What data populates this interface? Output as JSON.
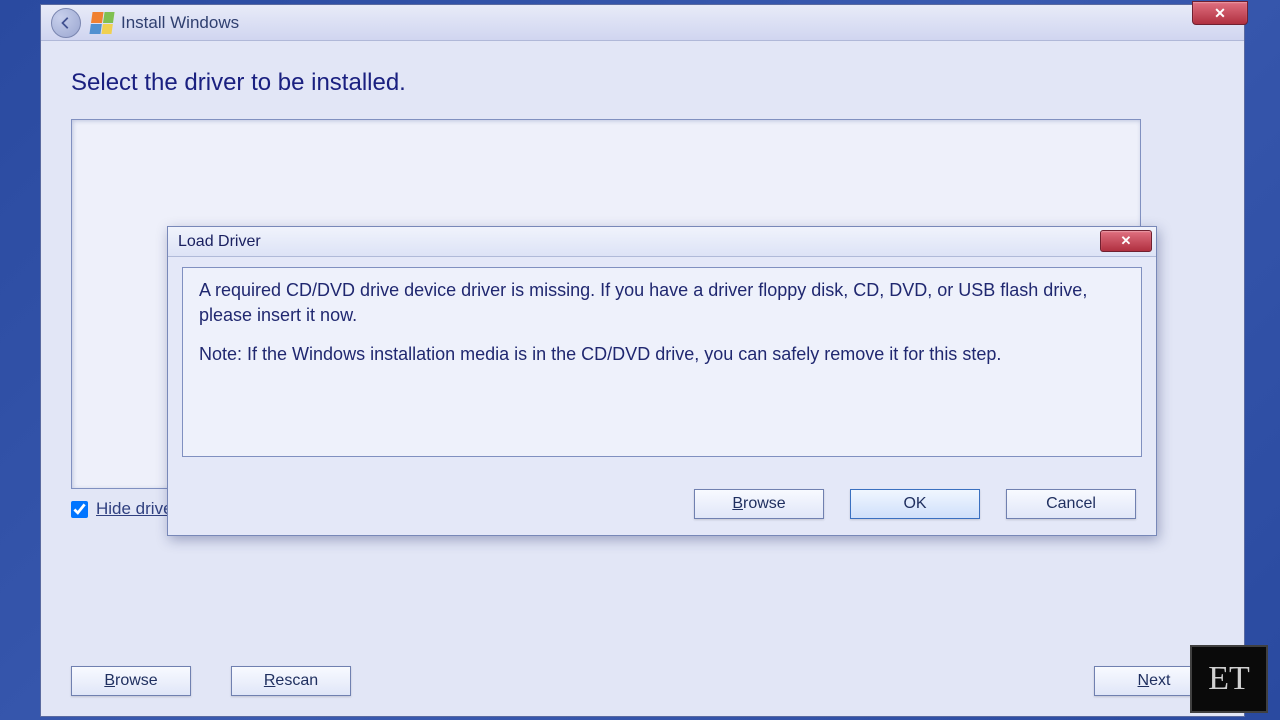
{
  "window": {
    "title": "Install Windows"
  },
  "page": {
    "heading": "Select the driver to be installed.",
    "hide_label": "Hide drivers that are not compatible with hardware on this computer.",
    "hide_checked": true,
    "buttons": {
      "browse": "Browse",
      "browse_accel": "B",
      "rescan": "Rescan",
      "rescan_accel": "R",
      "next": "Next",
      "next_accel": "N"
    }
  },
  "dialog": {
    "title": "Load Driver",
    "message_line1": "A required CD/DVD drive device driver is missing. If you have a driver floppy disk, CD, DVD, or USB flash drive, please insert it now.",
    "message_line2": "Note: If the Windows installation media is in the CD/DVD drive, you can safely remove it for this step.",
    "buttons": {
      "browse": "Browse",
      "browse_accel": "B",
      "ok": "OK",
      "cancel": "Cancel"
    }
  },
  "watermark": "ET"
}
